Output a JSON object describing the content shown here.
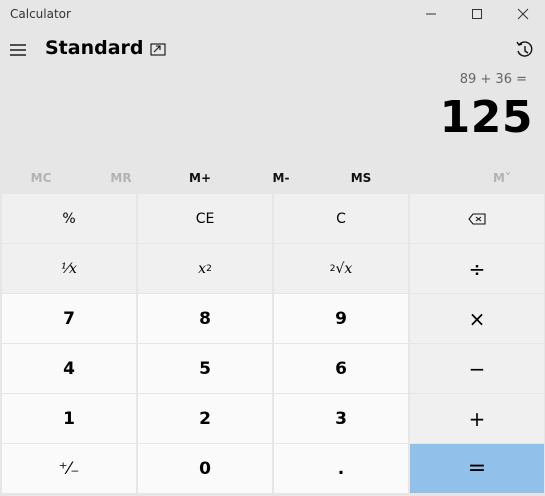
{
  "window": {
    "title": "Calculator",
    "icons": [
      "minimize-icon",
      "maximize-icon",
      "close-icon"
    ]
  },
  "header": {
    "mode": "Standard",
    "icons": [
      "hamburger-menu-icon",
      "keep-on-top-icon",
      "history-icon"
    ]
  },
  "display": {
    "expression": "89 + 36 =",
    "result": "125"
  },
  "memory": {
    "mc": "MC",
    "mr": "MR",
    "mplus": "M+",
    "mminus": "M-",
    "ms": "MS",
    "mlist": "M˅"
  },
  "keys": {
    "percent": "%",
    "ce": "CE",
    "c": "C",
    "backspace": "⌫",
    "reciprocal": "¹⁄x",
    "square_base": "x",
    "square_exp": "2",
    "sqrt_index": "2",
    "sqrt_sym": "√x",
    "divide": "÷",
    "seven": "7",
    "eight": "8",
    "nine": "9",
    "multiply": "×",
    "four": "4",
    "five": "5",
    "six": "6",
    "minus": "−",
    "one": "1",
    "two": "2",
    "three": "3",
    "plus": "+",
    "negate": "⁺⁄₋",
    "zero": "0",
    "decimal": ".",
    "equals": "="
  },
  "colors": {
    "background": "#e6e6e6",
    "number_key": "#fafafa",
    "function_key": "#f0f0f0",
    "equals_key": "#91c1ea",
    "disabled_text": "#b3b3b3"
  }
}
